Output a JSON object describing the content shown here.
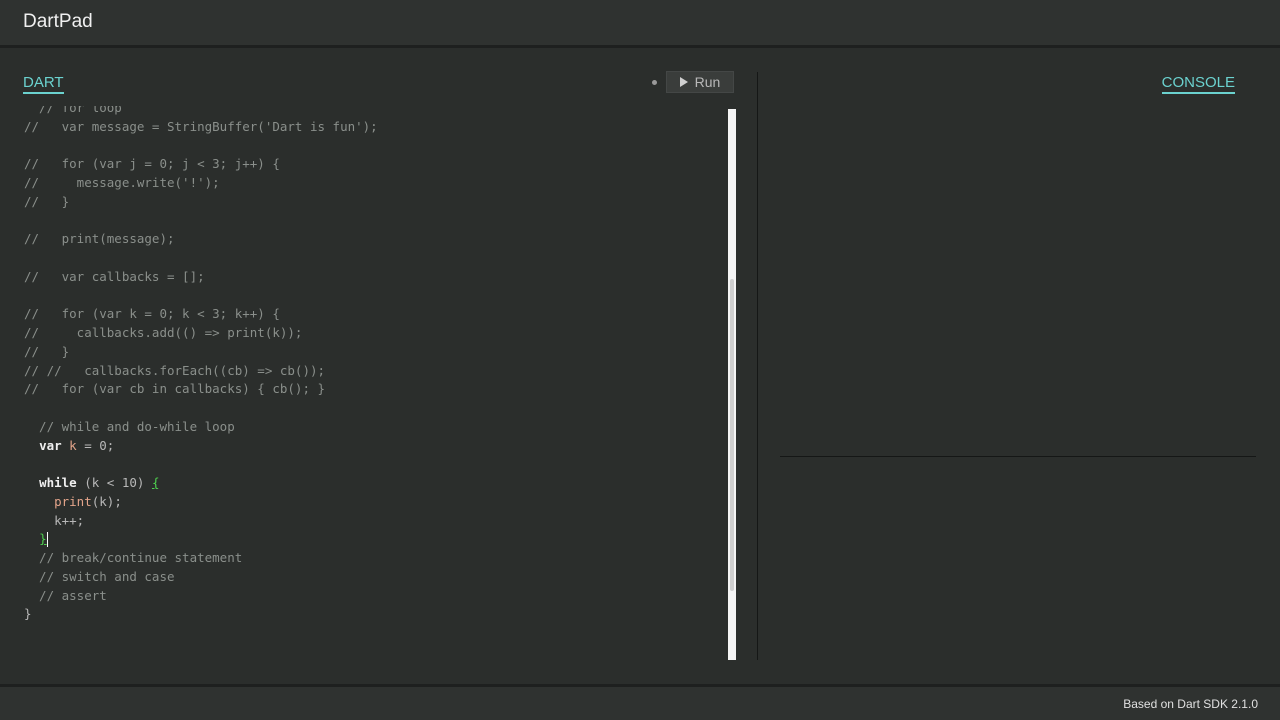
{
  "header": {
    "title": "DartPad"
  },
  "tabs": {
    "dart": "DART",
    "console": "CONSOLE"
  },
  "toolbar": {
    "run_label": "Run"
  },
  "editor": {
    "lines": [
      [
        {
          "t": "  // for loop",
          "k": "c"
        }
      ],
      [
        {
          "t": "//   var message = StringBuffer('Dart is fun');",
          "k": "c"
        }
      ],
      [],
      [
        {
          "t": "//   for (var j = 0; j < 3; j++) {",
          "k": "c"
        }
      ],
      [
        {
          "t": "//     message.write('!');",
          "k": "c"
        }
      ],
      [
        {
          "t": "//   }",
          "k": "c"
        }
      ],
      [],
      [
        {
          "t": "//   print(message);",
          "k": "c"
        }
      ],
      [],
      [
        {
          "t": "//   var callbacks = [];",
          "k": "c"
        }
      ],
      [],
      [
        {
          "t": "//   for (var k = 0; k < 3; k++) {",
          "k": "c"
        }
      ],
      [
        {
          "t": "//     callbacks.add(() => print(k));",
          "k": "c"
        }
      ],
      [
        {
          "t": "//   }",
          "k": "c"
        }
      ],
      [
        {
          "t": "// //   callbacks.forEach((cb) => cb());",
          "k": "c"
        }
      ],
      [
        {
          "t": "//   for (var cb in callbacks) { cb(); }",
          "k": "c"
        }
      ],
      [],
      [
        {
          "t": "  // while and do-while loop",
          "k": "c"
        }
      ],
      [
        {
          "t": "  "
        },
        {
          "t": "var",
          "k": "kw"
        },
        {
          "t": " "
        },
        {
          "t": "k",
          "k": "var"
        },
        {
          "t": " = 0;"
        }
      ],
      [],
      [
        {
          "t": "  "
        },
        {
          "t": "while",
          "k": "kw"
        },
        {
          "t": " (k < 10) "
        },
        {
          "t": "{",
          "k": "brace-hl"
        }
      ],
      [
        {
          "t": "    "
        },
        {
          "t": "print",
          "k": "fn"
        },
        {
          "t": "(k);"
        }
      ],
      [
        {
          "t": "    k++;"
        }
      ],
      [
        {
          "t": "  "
        },
        {
          "t": "}",
          "k": "brace-hl"
        },
        {
          "t": "",
          "k": "cursor"
        }
      ],
      [
        {
          "t": "  // break/continue statement",
          "k": "c"
        }
      ],
      [
        {
          "t": "  // switch and case",
          "k": "c"
        }
      ],
      [
        {
          "t": "  // assert",
          "k": "c"
        }
      ],
      [
        {
          "t": "}"
        }
      ]
    ]
  },
  "footer": {
    "sdk_label": "Based on Dart SDK 2.1.0"
  },
  "colors": {
    "accent": "#6bd2cf",
    "background": "#2b2e2c",
    "brace_match": "#4fd14f"
  }
}
